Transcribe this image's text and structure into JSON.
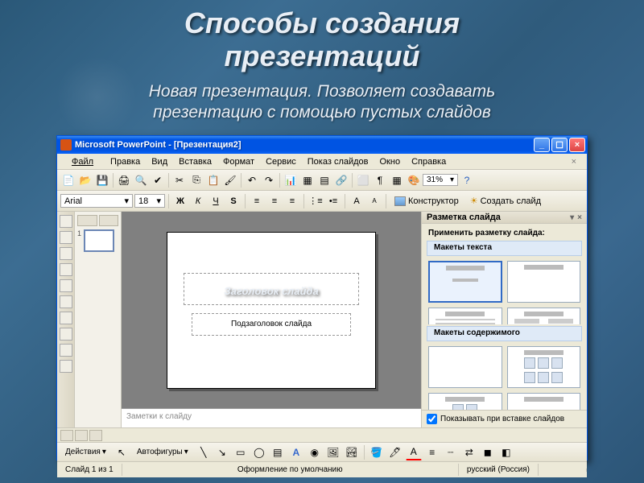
{
  "page": {
    "heading1": "Способы создания",
    "heading2": "презентаций",
    "sub1": "Новая презентация. Позволяет создавать",
    "sub2": "презентацию с помощью пустых слайдов"
  },
  "titlebar": {
    "text": "Microsoft PowerPoint - [Презентация2]"
  },
  "menu": {
    "file": "Файл",
    "edit": "Правка",
    "view": "Вид",
    "insert": "Вставка",
    "format": "Формат",
    "tools": "Сервис",
    "slideshow": "Показ слайдов",
    "window": "Окно",
    "help": "Справка"
  },
  "toolbar": {
    "zoom": "31%"
  },
  "font": {
    "name": "Arial",
    "size": "18",
    "bold": "Ж",
    "italic": "К",
    "underline": "Ч",
    "shadow": "S",
    "designer": "Конструктор",
    "newslide": "Создать слайд"
  },
  "slide": {
    "thumb_num": "1",
    "title_ph": "Заголовок слайда",
    "sub_ph": "Подзаголовок слайда",
    "notes": "Заметки к слайду"
  },
  "taskpane": {
    "header": "Разметка слайда",
    "apply": "Применить разметку слайда:",
    "text_layouts": "Макеты текста",
    "content_layouts": "Макеты содержимого",
    "show_on_insert": "Показывать при вставке слайдов"
  },
  "drawbar": {
    "actions": "Действия",
    "autoshapes": "Автофигуры"
  },
  "status": {
    "slideinfo": "Слайд 1 из 1",
    "design": "Оформление по умолчанию",
    "lang": "русский (Россия)"
  }
}
